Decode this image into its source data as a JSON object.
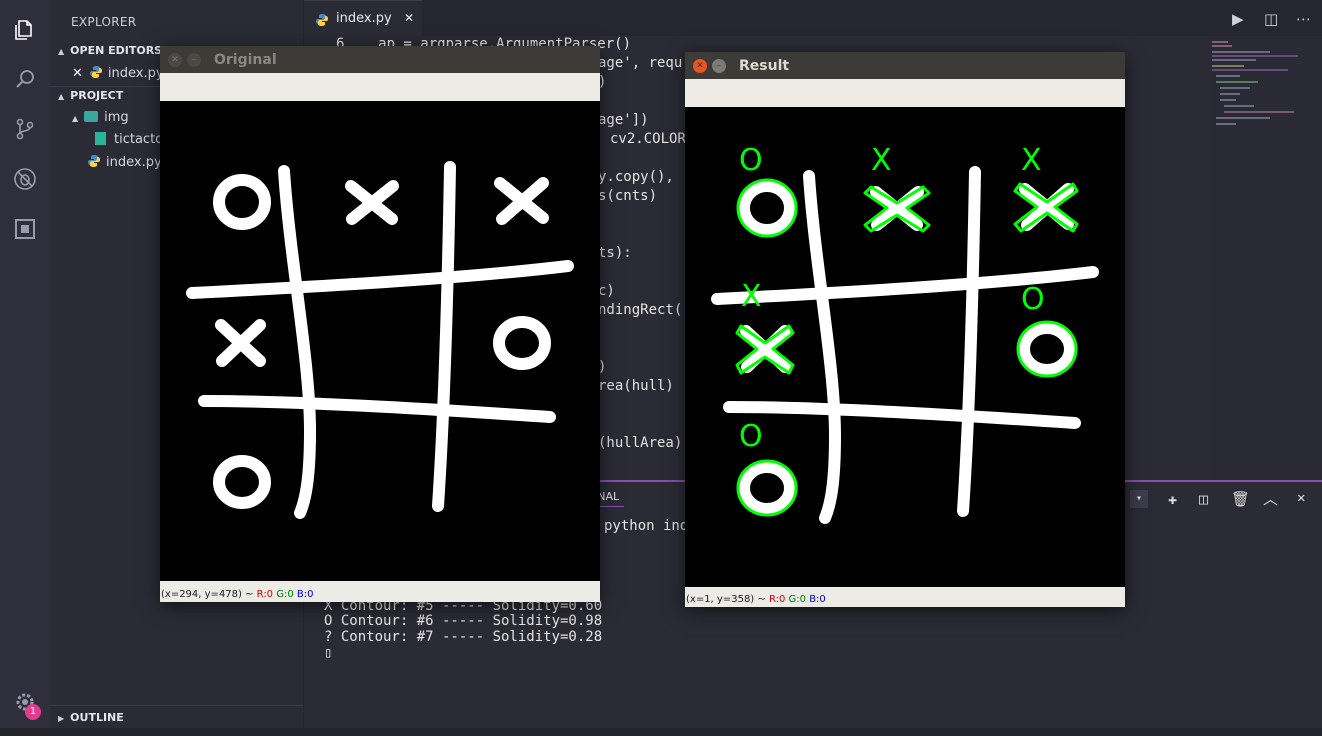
{
  "sidebar": {
    "title": "EXPLORER",
    "open_editors": "OPEN EDITORS",
    "open_file": "index.py",
    "project": "PROJECT",
    "folder_img": "img",
    "file_tictactoe": "tictacto",
    "file_index": "index.py",
    "outline": "OUTLINE",
    "badge": "1"
  },
  "editor": {
    "tab_label": "index.py",
    "tab_close": "✕",
    "lines": [
      "6    ap = argparse.ArgumentParser()",
      "age', requ",
      ")",
      "age'])",
      "cv2.COLOR",
      "y.copy(),",
      "s(cnts)",
      "ts):",
      "c)",
      "ndingRect(",
      ")",
      "rea(hull)",
      "(hullArea)"
    ]
  },
  "panel": {
    "tab_label": "INAL",
    "command": "python ind",
    "output": [
      "X Contour: #5 ----- Solidity=0.60",
      "O Contour: #6 ----- Solidity=0.98",
      "? Contour: #7 ----- Solidity=0.28"
    ],
    "cursor": "▯"
  },
  "window_original": {
    "title": "Original",
    "status_prefix": "(x=294, y=478) ~ ",
    "r": "R:0",
    "g": "G:0",
    "b": "B:0"
  },
  "window_result": {
    "title": "Result",
    "status_prefix": "(x=1, y=358) ~ ",
    "r": "R:0",
    "g": "G:0",
    "b": "B:0",
    "labels": [
      "O",
      "X",
      "X",
      "X",
      "O",
      "O"
    ]
  },
  "colors": {
    "accent": "#8a4fae",
    "detect_green": "#00ff00",
    "close_orange": "#e95420"
  }
}
